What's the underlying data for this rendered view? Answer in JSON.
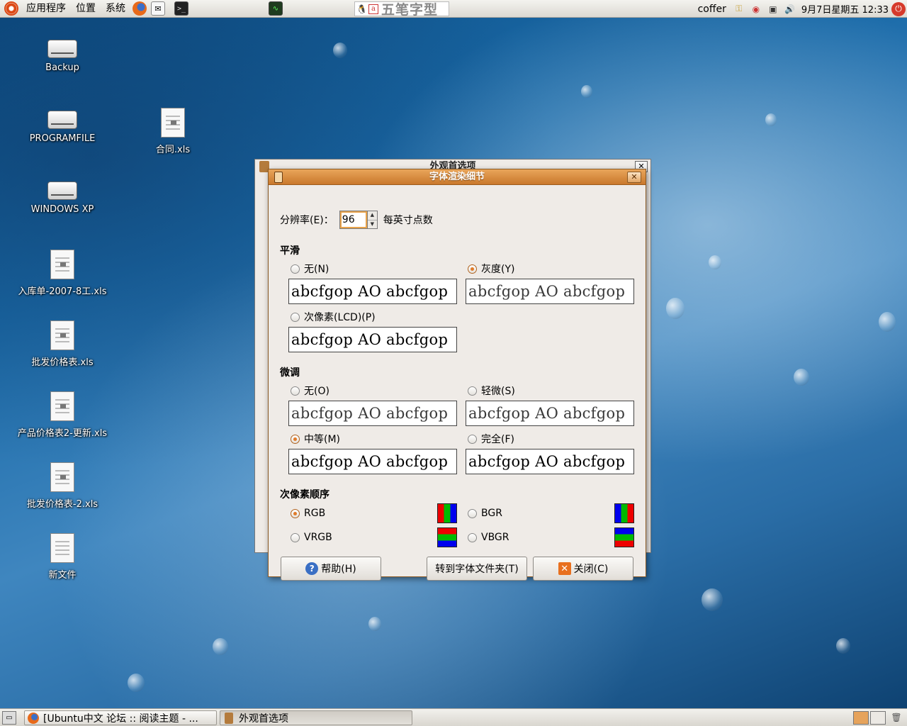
{
  "top_panel": {
    "menus": [
      "应用程序",
      "位置",
      "系统"
    ],
    "ime_text": "五笔字型",
    "username": "coffer",
    "clock": "9月7日星期五 12:33"
  },
  "desktop": {
    "icons": [
      {
        "label": "Backup",
        "icon": "drive-icon"
      },
      {
        "label": "PROGRAMFILE",
        "icon": "drive-icon"
      },
      {
        "label": "WINDOWS XP",
        "icon": "drive-icon"
      },
      {
        "label": "入库单-2007-8工.xls",
        "icon": "spreadsheet-icon"
      },
      {
        "label": "批发价格表.xls",
        "icon": "spreadsheet-icon"
      },
      {
        "label": "产品价格表2-更新.xls",
        "icon": "spreadsheet-icon"
      },
      {
        "label": "批发价格表-2.xls",
        "icon": "spreadsheet-icon"
      },
      {
        "label": "新文件",
        "icon": "text-file-icon"
      },
      {
        "label": "合同.xls",
        "icon": "spreadsheet-icon"
      }
    ]
  },
  "background_dialog": {
    "title": "外观首选项"
  },
  "dialog": {
    "title": "字体渲染细节",
    "resolution_label": "分辨率(E)：",
    "resolution_value": "96",
    "resolution_unit": "每英寸点数",
    "smoothing": {
      "title": "平滑",
      "options": [
        {
          "label": "无(N)",
          "checked": false
        },
        {
          "label": "灰度(Y)",
          "checked": true
        },
        {
          "label": "次像素(LCD)(P)",
          "checked": false
        }
      ]
    },
    "hinting": {
      "title": "微调",
      "options": [
        {
          "label": "无(O)",
          "checked": false
        },
        {
          "label": "轻微(S)",
          "checked": false
        },
        {
          "label": "中等(M)",
          "checked": true
        },
        {
          "label": "完全(F)",
          "checked": false
        }
      ]
    },
    "subpixel": {
      "title": "次像素顺序",
      "options": [
        {
          "label": "RGB",
          "checked": true
        },
        {
          "label": "BGR",
          "checked": false
        },
        {
          "label": "VRGB",
          "checked": false
        },
        {
          "label": "VBGR",
          "checked": false
        }
      ]
    },
    "preview_text": "abcfgop AO abcfgop",
    "buttons": {
      "help": "帮助(H)",
      "goto_folder": "转到字体文件夹(T)",
      "close": "关闭(C)"
    }
  },
  "bottom_panel": {
    "tasks": [
      {
        "label": "[Ubuntu中文 论坛 :: 阅读主题 - ...",
        "active": false
      },
      {
        "label": "外观首选项",
        "active": true
      }
    ]
  },
  "colors": {
    "accent": "#e07b2a",
    "titlebar": "#d98a3f"
  }
}
